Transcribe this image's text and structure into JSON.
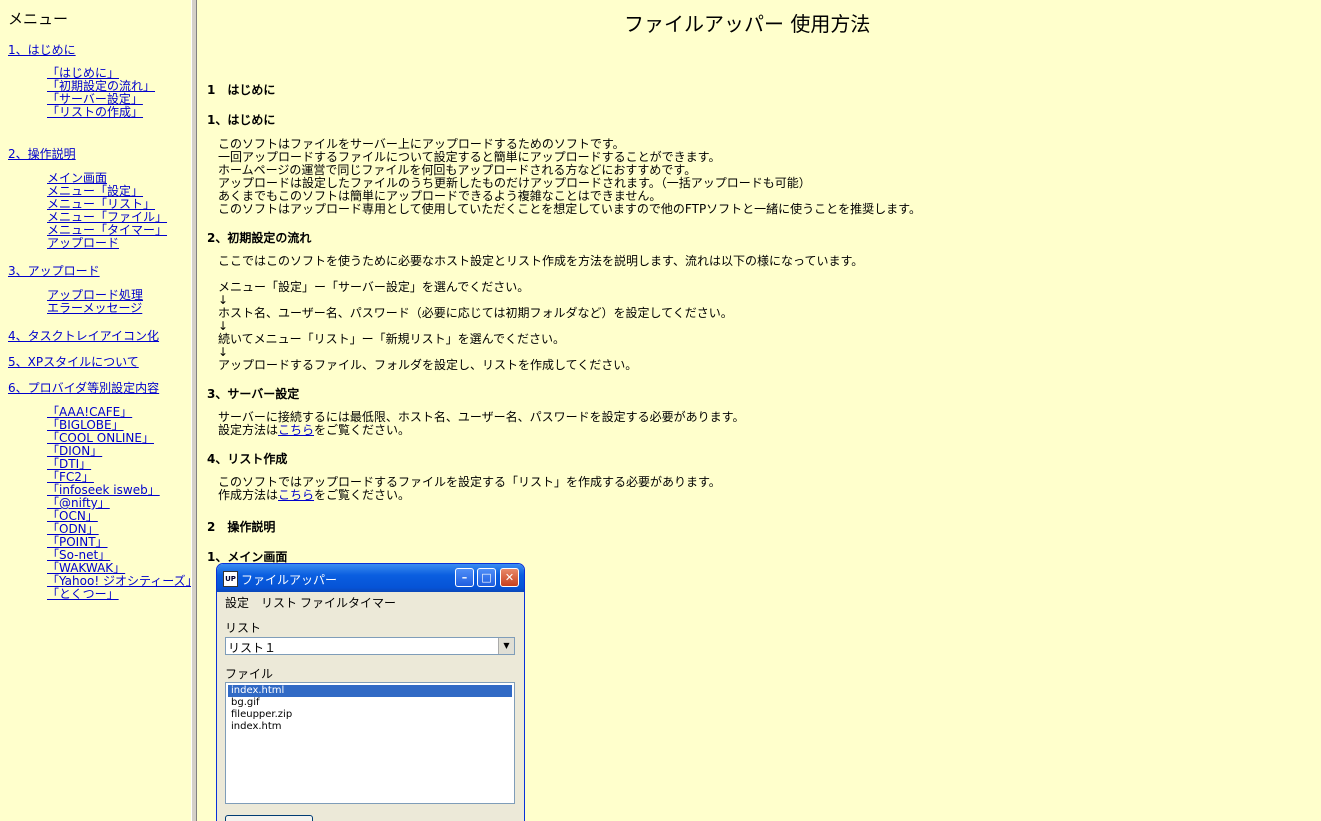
{
  "sidebar": {
    "title": "メニュー",
    "sections": [
      {
        "label": "1、はじめに",
        "items": [
          "「はじめに」",
          "「初期設定の流れ」",
          "「サーバー設定」",
          "「リストの作成」"
        ]
      },
      {
        "label": "2、操作説明",
        "items": [
          "メイン画面",
          "メニュー「設定」",
          "メニュー「リスト」",
          "メニュー「ファイル」",
          "メニュー「タイマー」",
          "アップロード"
        ]
      },
      {
        "label": "3、アップロード",
        "items": [
          "アップロード処理",
          "エラーメッセージ"
        ]
      },
      {
        "label": "4、タスクトレイアイコン化",
        "items": []
      },
      {
        "label": "5、XPスタイルについて",
        "items": []
      },
      {
        "label": "6、プロバイダ等別設定内容",
        "items": [
          "「AAA!CAFE」",
          "「BIGLOBE」",
          "「COOL ONLINE」",
          "「DION」",
          "「DTI」",
          "「FC2」",
          "「infoseek isweb」",
          "「@nifty」",
          "「OCN」",
          "「ODN」",
          "「POINT」",
          "「So-net」",
          "「WAKWAK」",
          "「Yahoo! ジオシティーズ」",
          "「とくつー」"
        ]
      }
    ]
  },
  "main": {
    "page_title": "ファイルアッパー 使用方法",
    "chapter1": "1　はじめに",
    "s1_title": "1、はじめに",
    "s1_lines": [
      "このソフトはファイルをサーバー上にアップロードするためのソフトです。",
      "一回アップロードするファイルについて設定すると簡単にアップロードすることができます。",
      "ホームページの運営で同じファイルを何回もアップロードされる方などにおすすめです。",
      "アップロードは設定したファイルのうち更新したものだけアップロードされます。（一括アップロードも可能）",
      "あくまでもこのソフトは簡単にアップロードできるよう複雑なことはできません。",
      "このソフトはアップロード専用として使用していただくことを想定していますので他のFTPソフトと一緒に使うことを推奨します。"
    ],
    "s2_title": "2、初期設定の流れ",
    "s2_intro": "ここではこのソフトを使うために必要なホスト設定とリスト作成を方法を説明します、流れは以下の様になっています。",
    "s2_flow": [
      "メニュー「設定」ー「サーバー設定」を選んでください。",
      "↓",
      "ホスト名、ユーザー名、パスワード（必要に応じては初期フォルダなど）を設定してください。",
      "↓",
      "続いてメニュー「リスト」ー「新規リスト」を選んでください。",
      "↓",
      "アップロードするファイル、フォルダを設定し、リストを作成してください。"
    ],
    "s3_title": "3、サーバー設定",
    "s3_line1": "サーバーに接続するには最低限、ホスト名、ユーザー名、パスワードを設定する必要があります。",
    "s3_line2_pre": "設定方法は",
    "s3_link": "こちら",
    "s3_line2_post": "をご覧ください。",
    "s4_title": "4、リスト作成",
    "s4_line1": "このソフトではアップロードするファイルを設定する「リスト」を作成する必要があります。",
    "s4_line2_pre": "作成方法は",
    "s4_link": "こちら",
    "s4_line2_post": "をご覧ください。",
    "chapter2": "2　操作説明",
    "s5_title": "1、メイン画面"
  },
  "app_window": {
    "title": "ファイルアッパー",
    "icon_text": "UP",
    "menus": [
      "設定",
      "リスト",
      "ファイル",
      "タイマー"
    ],
    "list_label": "リスト",
    "list_value": "リスト１",
    "file_label": "ファイル",
    "files": [
      "index.html",
      "bg.gif",
      "fileupper.zip",
      "index.htm"
    ],
    "selected_index": 0
  }
}
